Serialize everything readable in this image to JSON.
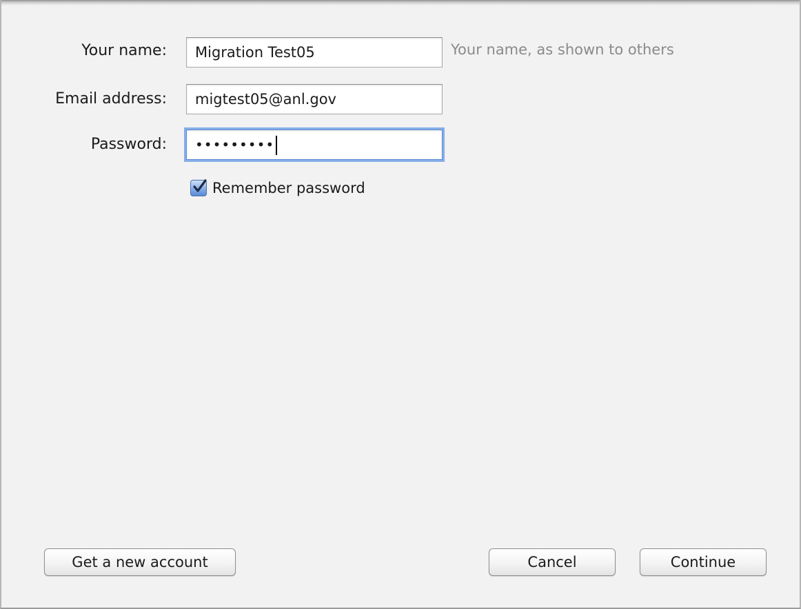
{
  "form": {
    "name_label": "Your name:",
    "name_value": "Migration Test05",
    "name_hint": "Your name, as shown to others",
    "email_label": "Email address:",
    "email_value": "migtest05@anl.gov",
    "password_label": "Password:",
    "password_mask": "•••••••••",
    "remember_label": "Remember password",
    "remember_checked": true
  },
  "buttons": {
    "new_account": "Get a new account",
    "cancel": "Cancel",
    "continue": "Continue"
  },
  "colors": {
    "background": "#f2f2f2",
    "focus_ring": "#86aee8",
    "checkbox": "#5a8ad6",
    "hint_text": "#8a8a8a"
  }
}
